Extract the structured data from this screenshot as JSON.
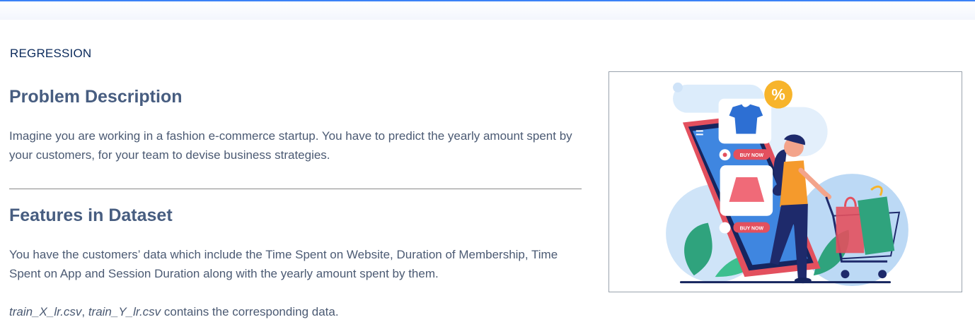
{
  "section_label": "REGRESSION",
  "problem": {
    "heading": "Problem Description",
    "text": "Imagine you are working in a fashion e-commerce startup. You have to predict the yearly amount spent by your customers, for your team to devise business strategies."
  },
  "features": {
    "heading": "Features in Dataset",
    "text": " You have the customers’ data which include the Time Spent on Website, Duration of Membership, Time Spent on App and Session Duration along with the yearly amount spent by them.",
    "file1": "train_X_lr.csv",
    "separator": ", ",
    "file2": "train_Y_lr.csv",
    "suffix": " contains the corresponding data."
  },
  "illustration": {
    "buy_now_label_1": "BUY NOW",
    "buy_now_label_2": "BUY NOW",
    "discount_symbol": "%"
  },
  "colors": {
    "accent": "#3b82f6",
    "heading": "#475d80",
    "category": "#0b2a5b",
    "body_text": "#4b5a73"
  }
}
